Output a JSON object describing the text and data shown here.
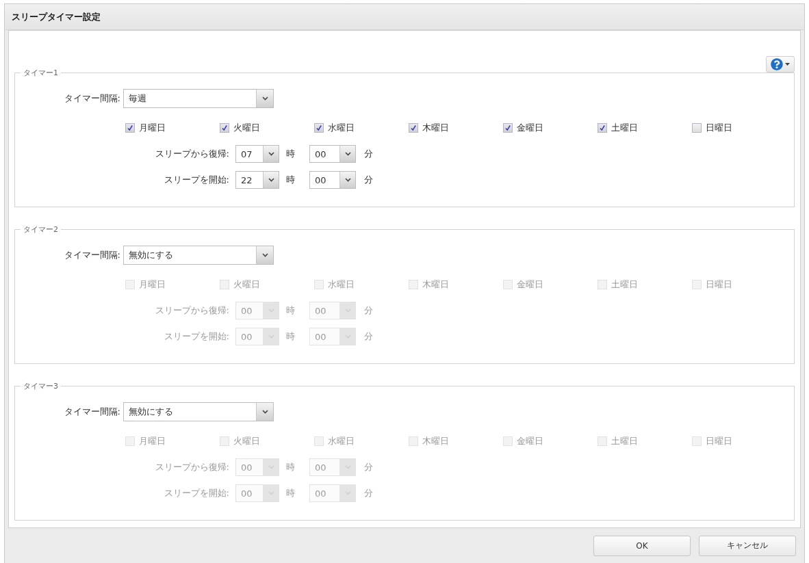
{
  "window": {
    "title": "スリープタイマー設定"
  },
  "timers": [
    {
      "legend": "タイマー1",
      "disabled": false,
      "interval": {
        "label": "タイマー間隔:",
        "value": "毎週"
      },
      "days": [
        {
          "label": "月曜日",
          "checked": true
        },
        {
          "label": "火曜日",
          "checked": true
        },
        {
          "label": "水曜日",
          "checked": true
        },
        {
          "label": "木曜日",
          "checked": true
        },
        {
          "label": "金曜日",
          "checked": true
        },
        {
          "label": "土曜日",
          "checked": true
        },
        {
          "label": "日曜日",
          "checked": false
        }
      ],
      "times": [
        {
          "label": "スリープから復帰:",
          "hour": "07",
          "hour_unit": "時",
          "minute": "00",
          "minute_unit": "分"
        },
        {
          "label": "スリープを開始:",
          "hour": "22",
          "hour_unit": "時",
          "minute": "00",
          "minute_unit": "分"
        }
      ]
    },
    {
      "legend": "タイマー2",
      "disabled": true,
      "interval": {
        "label": "タイマー間隔:",
        "value": "無効にする"
      },
      "days": [
        {
          "label": "月曜日",
          "checked": false
        },
        {
          "label": "火曜日",
          "checked": false
        },
        {
          "label": "水曜日",
          "checked": false
        },
        {
          "label": "木曜日",
          "checked": false
        },
        {
          "label": "金曜日",
          "checked": false
        },
        {
          "label": "土曜日",
          "checked": false
        },
        {
          "label": "日曜日",
          "checked": false
        }
      ],
      "times": [
        {
          "label": "スリープから復帰:",
          "hour": "00",
          "hour_unit": "時",
          "minute": "00",
          "minute_unit": "分"
        },
        {
          "label": "スリープを開始:",
          "hour": "00",
          "hour_unit": "時",
          "minute": "00",
          "minute_unit": "分"
        }
      ]
    },
    {
      "legend": "タイマー3",
      "disabled": true,
      "interval": {
        "label": "タイマー間隔:",
        "value": "無効にする"
      },
      "days": [
        {
          "label": "月曜日",
          "checked": false
        },
        {
          "label": "火曜日",
          "checked": false
        },
        {
          "label": "水曜日",
          "checked": false
        },
        {
          "label": "木曜日",
          "checked": false
        },
        {
          "label": "金曜日",
          "checked": false
        },
        {
          "label": "土曜日",
          "checked": false
        },
        {
          "label": "日曜日",
          "checked": false
        }
      ],
      "times": [
        {
          "label": "スリープから復帰:",
          "hour": "00",
          "hour_unit": "時",
          "minute": "00",
          "minute_unit": "分"
        },
        {
          "label": "スリープを開始:",
          "hour": "00",
          "hour_unit": "時",
          "minute": "00",
          "minute_unit": "分"
        }
      ]
    }
  ],
  "buttons": [
    {
      "label": "OK"
    },
    {
      "label": "キャンセル"
    }
  ]
}
